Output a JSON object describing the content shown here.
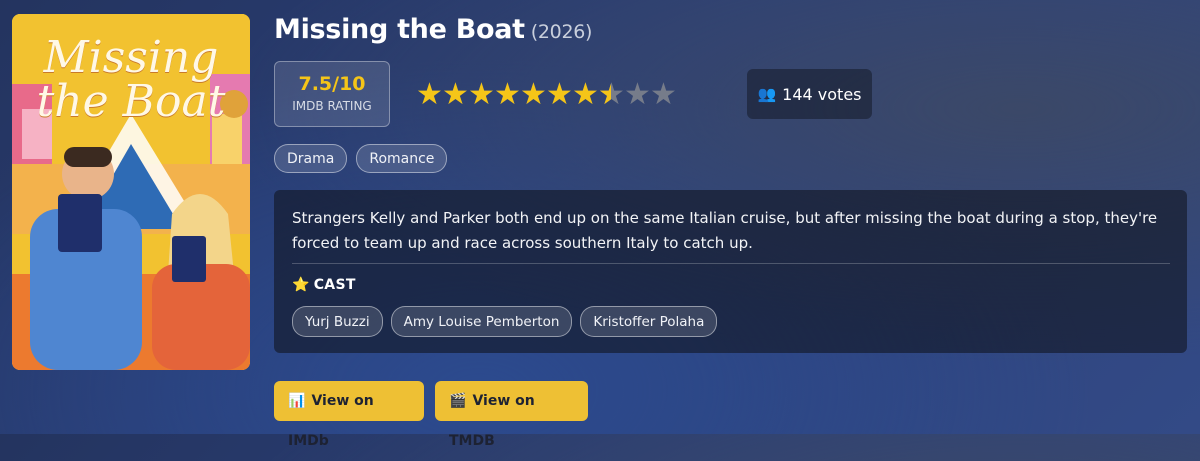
{
  "poster": {
    "title_line1": "Missing",
    "title_line2": "the Boat"
  },
  "movie": {
    "title": "Missing the Boat",
    "year": "(2026)"
  },
  "rating": {
    "value": "7.5/10",
    "label": "IMDB RATING",
    "stars_filled": 7.5,
    "stars_total": 10
  },
  "votes": {
    "icon": "people-icon",
    "text": "144 votes"
  },
  "genres": [
    "Drama",
    "Romance"
  ],
  "description": "Strangers Kelly and Parker both end up on the same Italian cruise, but after missing the boat during a stop, they're forced to team up and race across southern Italy to catch up.",
  "cast": {
    "heading": "CAST",
    "icon": "star-icon",
    "members": [
      "Yurj Buzzi",
      "Amy Louise Pemberton",
      "Kristoffer Polaha"
    ]
  },
  "buttons": {
    "imdb": {
      "icon": "chart-icon",
      "label": "View on IMDb"
    },
    "tmdb": {
      "icon": "clapper-icon",
      "label": "View on TMDB"
    }
  },
  "colors": {
    "accent": "#f5c518",
    "button": "#eec034"
  }
}
